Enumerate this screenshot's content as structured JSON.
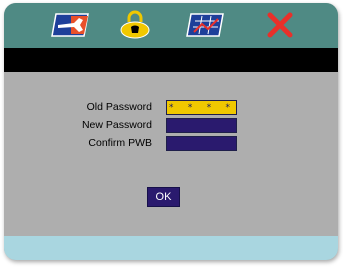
{
  "tabs": [
    {
      "icon": "wrench-icon"
    },
    {
      "icon": "lock-icon"
    },
    {
      "icon": "chart-icon"
    },
    {
      "icon": "close-x-icon"
    }
  ],
  "form": {
    "old_password": {
      "label": "Old Password",
      "value": "* * * *"
    },
    "new_password": {
      "label": "New Password",
      "value": ""
    },
    "confirm_password": {
      "label": "Confirm PWB",
      "value": ""
    }
  },
  "ok_button": {
    "label": "OK"
  },
  "colors": {
    "tab_bar": "#4f8a84",
    "panel": "#aeaeae",
    "header_band": "#000000",
    "footer_band": "#a9d6e0",
    "field_active": "#f0c800",
    "field_inactive": "#2a1a6e",
    "close_icon": "#e8302a"
  }
}
